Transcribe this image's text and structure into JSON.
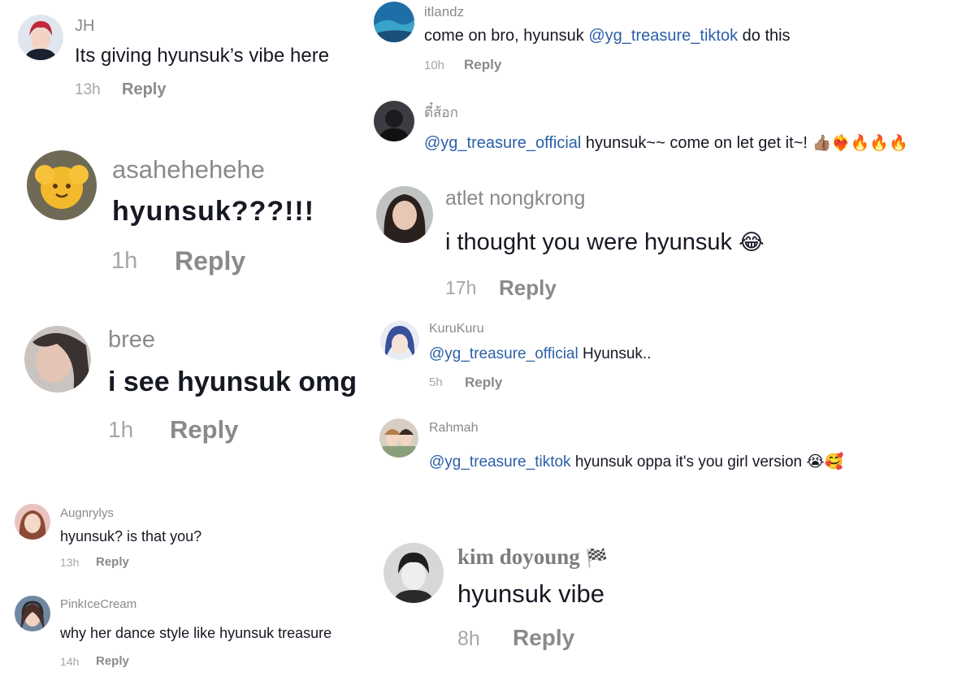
{
  "comments": [
    {
      "user": "JH",
      "text": "Its giving hyunsuk’s vibe here",
      "time": "13h",
      "reply": "Reply"
    },
    {
      "user": "asahehehehe",
      "text": "hyunsuk???!!!",
      "time": "1h",
      "reply": "Reply"
    },
    {
      "user": "bree",
      "text": "i see hyunsuk omg",
      "time": "1h",
      "reply": "Reply"
    },
    {
      "user": "Augnrylys",
      "text": "hyunsuk? is that you?",
      "time": "13h",
      "reply": "Reply"
    },
    {
      "user": "PinkIceCream",
      "text": "why her dance style like hyunsuk treasure",
      "time": "14h",
      "reply": "Reply"
    },
    {
      "user": "itlandz",
      "text_before": "come on bro, hyunsuk ",
      "mention": "@yg_treasure_tiktok",
      "text_after": " do this",
      "time": "10h",
      "reply": "Reply"
    },
    {
      "user": "ตี๋ส้อก",
      "mention": "@yg_treasure_official",
      "text_after": " hyunsuk~~ come on let get it~!",
      "emojis": "👍🏽❤️‍🔥🔥🔥🔥"
    },
    {
      "user": "atlet nongkrong",
      "text": "i thought you were hyunsuk",
      "emojis": "😂",
      "time": "17h",
      "reply": "Reply"
    },
    {
      "user": "KuruKuru",
      "mention": "@yg_treasure_official",
      "text_after": " Hyunsuk..",
      "time": "5h",
      "reply": "Reply"
    },
    {
      "user": "Rahmah",
      "mention": "@yg_treasure_tiktok",
      "text_after": " hyunsuk oppa it's you girl version",
      "emojis": "😭🥰"
    },
    {
      "user": "kim doyoung",
      "user_emoji": "🏁",
      "text": "hyunsuk vibe",
      "time": "8h",
      "reply": "Reply"
    }
  ],
  "avatars": {
    "JH": "person-red-hair-avatar",
    "asahehehehe": "yellow-flower-plush-avatar",
    "bree": "bree-photo-avatar",
    "Augnrylys": "anime-girl-avatar",
    "PinkIceCream": "headphones-girl-avatar",
    "itlandz": "ocean-avatar",
    "ตี๋ส้อก": "dark-portrait-avatar",
    "atlet nongkrong": "girl-portrait-avatar",
    "KuruKuru": "anime-blue-hair-avatar",
    "Rahmah": "couple-photo-avatar",
    "kim doyoung": "bw-portrait-avatar"
  },
  "colors": {
    "username": "#8a8a8a",
    "text": "#161823",
    "mention": "#2b5fa8",
    "time": "#a6a6a6",
    "reply": "#8a8a8a",
    "background": "#ffffff"
  }
}
